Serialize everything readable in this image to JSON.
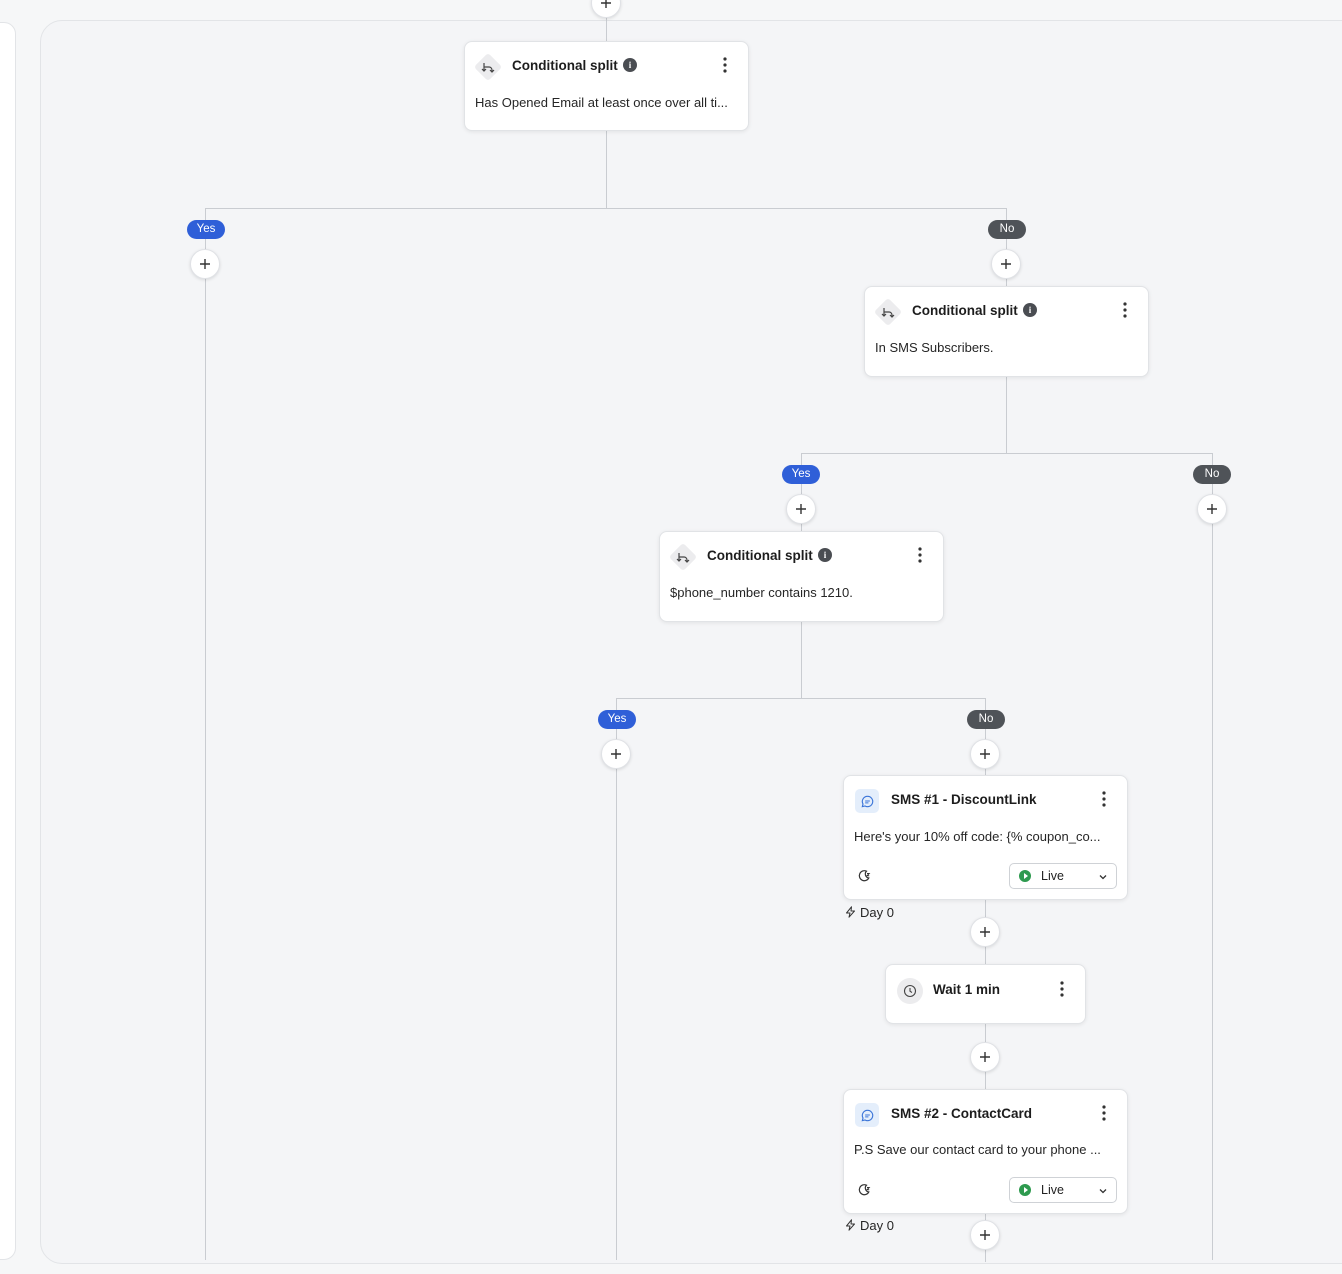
{
  "flow": {
    "split1": {
      "title": "Conditional split",
      "desc": "Has Opened Email at least once over all ti..."
    },
    "split2": {
      "title": "Conditional split",
      "desc": "In SMS Subscribers."
    },
    "split3": {
      "title": "Conditional split",
      "desc": "$phone_number contains 1210."
    },
    "branch": {
      "yes": "Yes",
      "no": "No"
    },
    "sms1": {
      "title": "SMS #1 - DiscountLink",
      "desc": "Here's your 10% off code: {% coupon_co...",
      "status": "Live",
      "day": "Day 0"
    },
    "wait": {
      "title": "Wait 1 min"
    },
    "sms2": {
      "title": "SMS #2 - ContactCard",
      "desc": "P.S Save our contact card to your phone ...",
      "status": "Live",
      "day": "Day 0"
    }
  },
  "icons": {
    "add": "plus-icon",
    "split": "split-icon",
    "info": "info-icon",
    "menu": "more-vertical-icon",
    "sms": "message-icon",
    "quiet_hours": "moon-icon",
    "live": "play-icon",
    "dropdown": "chevron-down-icon",
    "trigger": "lightning-icon",
    "clock": "clock-icon"
  },
  "colors": {
    "yes_pill": "#2f5fd8",
    "no_pill": "#4f5358",
    "live": "#2e9a4f",
    "sms_icon_bg": "#e4eefb"
  }
}
